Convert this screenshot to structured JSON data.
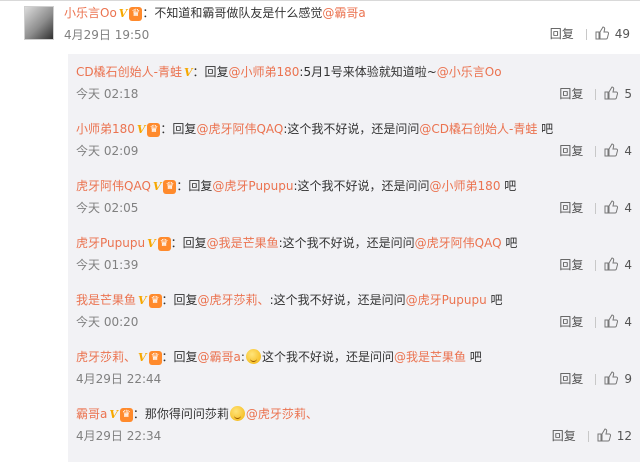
{
  "main": {
    "username": "小乐言Oo",
    "badge_v": "V",
    "badge_crown": "♛",
    "text": "：不知道和霸哥做队友是什么感觉",
    "mention": "@霸哥a",
    "timestamp": "4月29日 19:50",
    "reply_label": "回复",
    "like_count": "49"
  },
  "replies": [
    {
      "username": "CD橇石创始人-青蛙",
      "prefix": "：回复",
      "mention1": "@小师弟180",
      "text1": ":5月1号来体验就知道啦~",
      "mention2": "@小乐言Oo",
      "text2": "",
      "timestamp": "今天 02:18",
      "reply_label": "回复",
      "like_count": "5"
    },
    {
      "username": "小师弟180",
      "prefix": "：回复",
      "mention1": "@虎牙阿伟QAQ",
      "text1": ":这个我不好说，还是问问",
      "mention2": "@CD橇石创始人-青蛙",
      "text2": " 吧",
      "timestamp": "今天 02:09",
      "reply_label": "回复",
      "like_count": "4"
    },
    {
      "username": "虎牙阿伟QAQ",
      "prefix": "：回复",
      "mention1": "@虎牙Pupupu",
      "text1": ":这个我不好说，还是问问",
      "mention2": "@小师弟180",
      "text2": " 吧",
      "timestamp": "今天 02:05",
      "reply_label": "回复",
      "like_count": "4"
    },
    {
      "username": "虎牙Pupupu",
      "prefix": "：回复",
      "mention1": "@我是芒果鱼",
      "text1": ":这个我不好说，还是问问",
      "mention2": "@虎牙阿伟QAQ",
      "text2": " 吧",
      "timestamp": "今天 01:39",
      "reply_label": "回复",
      "like_count": "4"
    },
    {
      "username": "我是芒果鱼",
      "prefix": "：回复",
      "mention1": "@虎牙莎莉、",
      "text1": ":这个我不好说，还是问问",
      "mention2": "@虎牙Pupupu",
      "text2": " 吧",
      "timestamp": "今天 00:20",
      "reply_label": "回复",
      "like_count": "4"
    },
    {
      "username": "虎牙莎莉、",
      "prefix": "：回复",
      "mention1": "@霸哥a",
      "text1": ":",
      "emoji": "smile-emoji",
      "text1b": "这个我不好说，还是问问",
      "mention2": "@我是芒果鱼",
      "text2": " 吧",
      "timestamp": "4月29日 22:44",
      "reply_label": "回复",
      "like_count": "9"
    },
    {
      "username": "霸哥a",
      "prefix": "：那你得问问莎莉",
      "emoji": "shy-emoji",
      "mention1": "@虎牙莎莉、",
      "timestamp": "4月29日 22:34",
      "reply_label": "回复",
      "like_count": "12"
    }
  ],
  "colors": {
    "username": "#eb7350",
    "text": "#333333",
    "meta": "#808080",
    "panel_bg": "#f2f2f5"
  },
  "icons": {
    "like": "thumbs-up-icon",
    "verified": "v-badge-icon",
    "member": "crown-badge-icon"
  }
}
